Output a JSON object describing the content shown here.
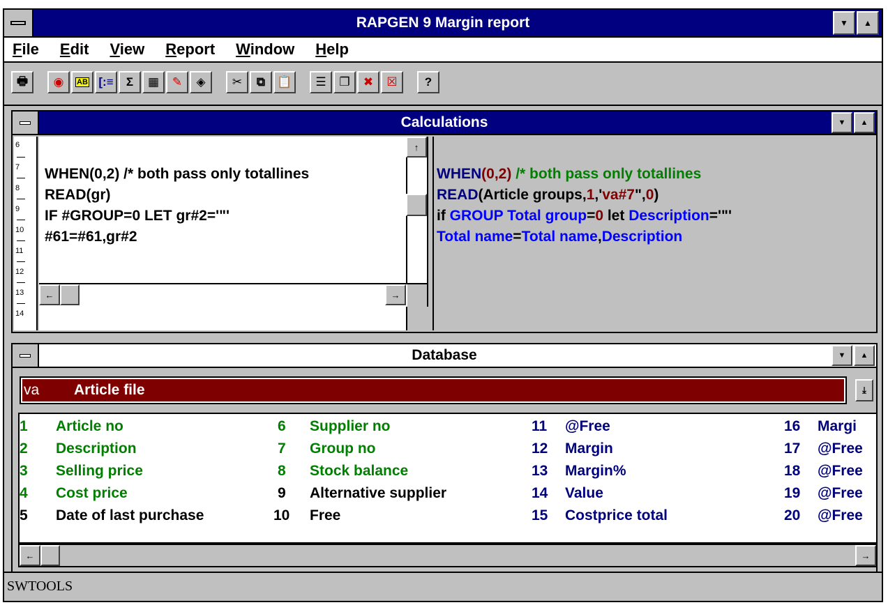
{
  "app": {
    "title": "RAPGEN 9 Margin report"
  },
  "menu": [
    "File",
    "Edit",
    "View",
    "Report",
    "Window",
    "Help"
  ],
  "toolbar": {
    "icons": [
      "print-icon",
      "browse-icon",
      "text-field-icon",
      "list-icon",
      "sum-icon",
      "calculator-icon",
      "edit-form-icon",
      "tag-icon",
      "cut-icon",
      "copy-icon",
      "paste-icon",
      "layout-icon",
      "cascade-windows-icon",
      "delete-field-icon",
      "delete-icon",
      "help-icon"
    ]
  },
  "calculations": {
    "title": "Calculations",
    "line_numbers": [
      "6",
      "7",
      "8",
      "9",
      "10",
      "11",
      "12",
      "13",
      "14"
    ],
    "left_lines": [
      "WHEN(0,2) /* both pass only totallines",
      "READ(gr)",
      "IF #GROUP=0 LET gr#2='\"'",
      "#61=#61,gr#2"
    ],
    "right": {
      "l1": {
        "kw": "WHEN",
        "p1": "(",
        "n1": "0,2",
        "p2": ")",
        "comment": " /* both pass only totallines"
      },
      "l2": {
        "kw": "READ",
        "a": "(Article groups,",
        "n1": "1",
        "b": ",'",
        "n2": "va#7",
        "c": "\",",
        "n3": "0",
        "d": ")"
      },
      "l3": {
        "a": "if ",
        "f1": "GROUP Total group",
        "b": "=",
        "n1": "0",
        "c": " let ",
        "f2": "Description",
        "d": "='\"'"
      },
      "l4": {
        "f1": "Total name",
        "a": "=",
        "f2": "Total name",
        "b": ",",
        "f3": "Description"
      }
    }
  },
  "database": {
    "title": "Database",
    "file_code": "va",
    "file_name": "Article file",
    "fields": [
      {
        "num": "1",
        "label": "Article no"
      },
      {
        "num": "2",
        "label": "Description"
      },
      {
        "num": "3",
        "label": "Selling price"
      },
      {
        "num": "4",
        "label": "Cost price"
      },
      {
        "num": "5",
        "label": "Date of last purchase"
      },
      {
        "num": "6",
        "label": "Supplier no"
      },
      {
        "num": "7",
        "label": "Group no"
      },
      {
        "num": "8",
        "label": "Stock balance"
      },
      {
        "num": "9",
        "label": "Alternative supplier"
      },
      {
        "num": "10",
        "label": "Free"
      },
      {
        "num": "11",
        "label": "@Free"
      },
      {
        "num": "12",
        "label": "Margin"
      },
      {
        "num": "13",
        "label": "Margin%"
      },
      {
        "num": "14",
        "label": "Value"
      },
      {
        "num": "15",
        "label": "Costprice total"
      },
      {
        "num": "16",
        "label": "Margi"
      },
      {
        "num": "17",
        "label": "@Free"
      },
      {
        "num": "18",
        "label": "@Free"
      },
      {
        "num": "19",
        "label": "@Free"
      },
      {
        "num": "20",
        "label": "@Free"
      }
    ]
  },
  "status": {
    "text": "SWTOOLS"
  },
  "colors": {
    "active_title": "#000080",
    "file_bar": "#7f0000",
    "comment": "#007f00",
    "keyword": "#00007f",
    "number": "#7f0000",
    "field": "#0000ff"
  }
}
